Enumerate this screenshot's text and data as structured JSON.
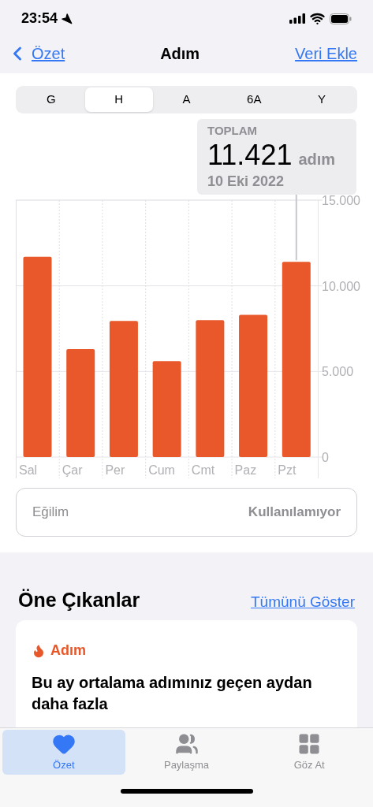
{
  "status_bar": {
    "time": "23:54"
  },
  "nav": {
    "back": "Özet",
    "title": "Adım",
    "action": "Veri Ekle"
  },
  "segments": [
    {
      "label": "G",
      "selected": false
    },
    {
      "label": "H",
      "selected": true
    },
    {
      "label": "A",
      "selected": false
    },
    {
      "label": "6A",
      "selected": false
    },
    {
      "label": "Y",
      "selected": false
    }
  ],
  "summary": {
    "caption": "TOPLAM",
    "value": "11.421",
    "unit": "adım",
    "date": "10 Eki 2022"
  },
  "chart_data": {
    "type": "bar",
    "categories": [
      "Sal",
      "Çar",
      "Per",
      "Cum",
      "Cmt",
      "Paz",
      "Pzt"
    ],
    "series": [
      {
        "color": "#e8582a",
        "values": [
          11700,
          6300,
          7950,
          5600,
          8000,
          8300,
          11400
        ]
      }
    ],
    "ylim": [
      0,
      15000
    ],
    "yticks": [
      {
        "value": 0,
        "label": "0"
      },
      {
        "value": 5000,
        "label": "5.000"
      },
      {
        "value": 10000,
        "label": "10.000"
      },
      {
        "value": 15000,
        "label": "15.000"
      }
    ],
    "annotations": [
      {
        "x": "Pzt"
      }
    ]
  },
  "trend": {
    "label": "Eğilim",
    "value": "Kullanılamıyor"
  },
  "highlights": {
    "title": "Öne Çıkanlar",
    "link": "Tümünü Göster",
    "card": {
      "category": "Adım",
      "text": "Bu ay ortalama adımınız geçen aydan daha fazla"
    }
  },
  "tab_bar": [
    {
      "kind": "heart",
      "label": "Özet",
      "selected": true
    },
    {
      "kind": "people",
      "label": "Paylaşma",
      "selected": false
    },
    {
      "kind": "grid",
      "label": "Göz At",
      "selected": false
    }
  ]
}
